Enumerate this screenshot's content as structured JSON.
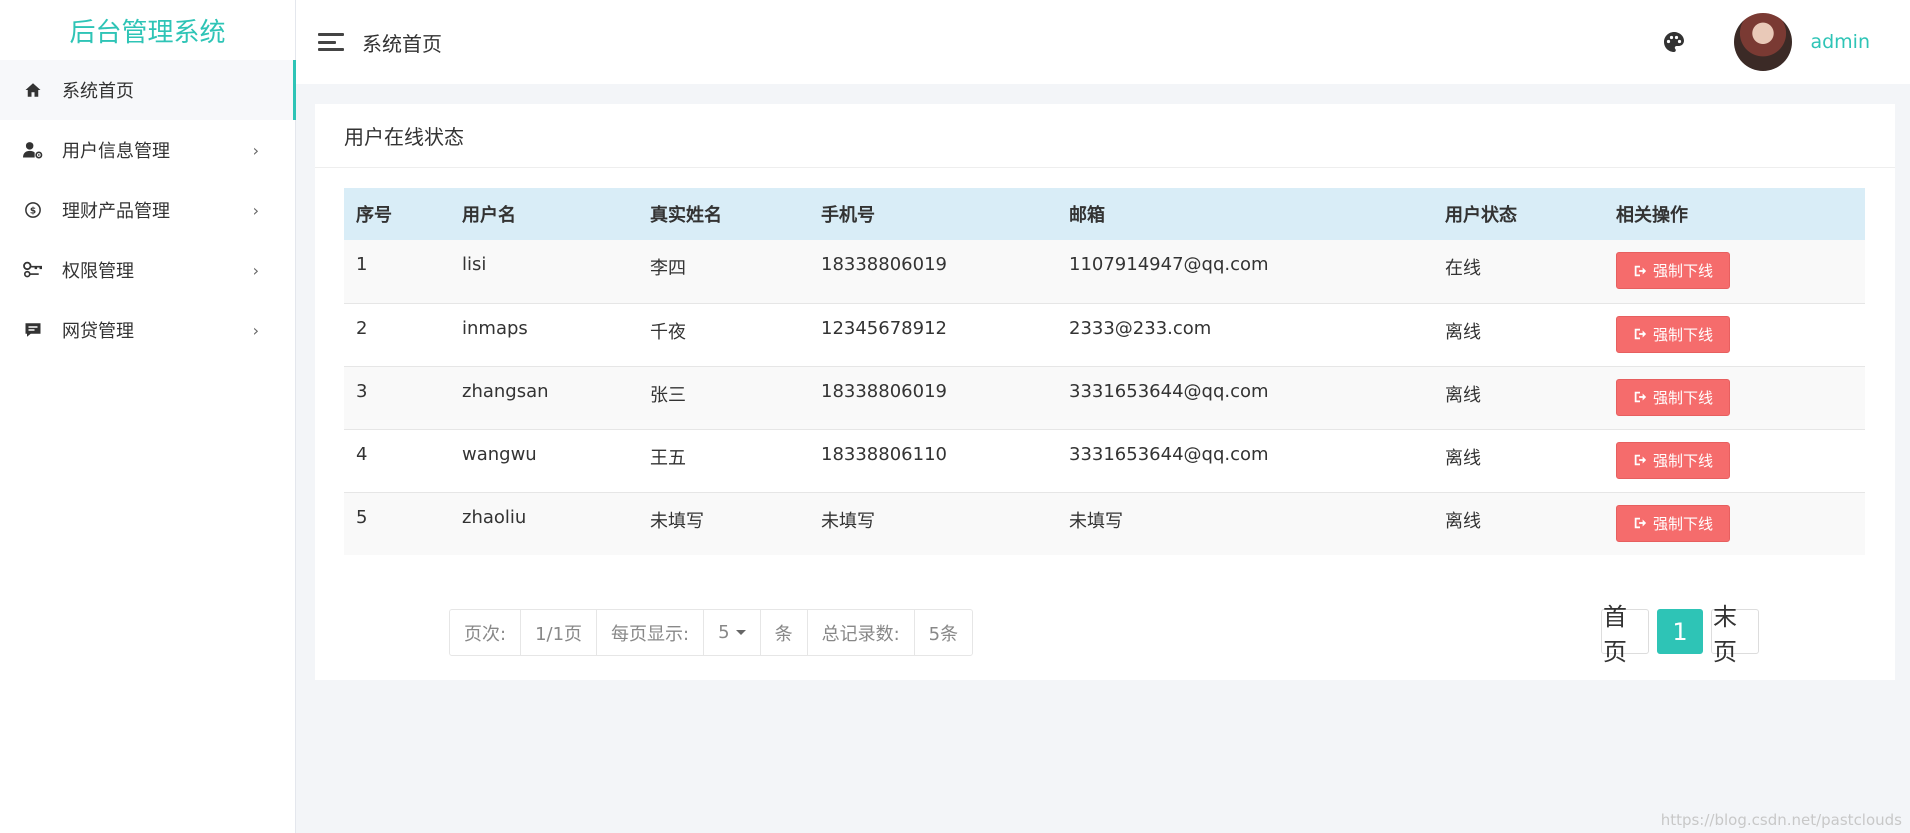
{
  "app": {
    "title": "后台管理系统"
  },
  "sidebar": {
    "items": [
      {
        "label": "系统首页",
        "icon": "home-icon",
        "active": true,
        "has_arrow": false
      },
      {
        "label": "用户信息管理",
        "icon": "user-settings-icon",
        "active": false,
        "has_arrow": true
      },
      {
        "label": "理财产品管理",
        "icon": "finance-icon",
        "active": false,
        "has_arrow": true
      },
      {
        "label": "权限管理",
        "icon": "key-icon",
        "active": false,
        "has_arrow": true
      },
      {
        "label": "网贷管理",
        "icon": "message-icon",
        "active": false,
        "has_arrow": true
      }
    ],
    "arrow": "›"
  },
  "header": {
    "breadcrumb": "系统首页",
    "username": "admin"
  },
  "card": {
    "title": "用户在线状态",
    "columns": [
      "序号",
      "用户名",
      "真实姓名",
      "手机号",
      "邮箱",
      "用户状态",
      "相关操作"
    ],
    "rows": [
      {
        "no": "1",
        "username": "lisi",
        "realname": "李四",
        "phone": "18338806019",
        "email": "1107914947@qq.com",
        "status": "在线",
        "action": "强制下线"
      },
      {
        "no": "2",
        "username": "inmaps",
        "realname": "千夜",
        "phone": "12345678912",
        "email": "2333@233.com",
        "status": "离线",
        "action": "强制下线"
      },
      {
        "no": "3",
        "username": "zhangsan",
        "realname": "张三",
        "phone": "18338806019",
        "email": "3331653644@qq.com",
        "status": "离线",
        "action": "强制下线"
      },
      {
        "no": "4",
        "username": "wangwu",
        "realname": "王五",
        "phone": "18338806110",
        "email": "3331653644@qq.com",
        "status": "离线",
        "action": "强制下线"
      },
      {
        "no": "5",
        "username": "zhaoliu",
        "realname": "未填写",
        "phone": "未填写",
        "email": "未填写",
        "status": "离线",
        "action": "强制下线"
      }
    ]
  },
  "pagination": {
    "page_label": "页次:",
    "page_value": "1/1页",
    "per_page_label": "每页显示:",
    "per_page_value": "5",
    "per_page_unit": "条",
    "total_label": "总记录数:",
    "total_value": "5条",
    "first": "首页",
    "current": "1",
    "last": "末页"
  },
  "watermark": "https://blog.csdn.net/pastclouds",
  "colors": {
    "accent": "#2ec4b6",
    "danger": "#f56c6c",
    "table_header": "#d9edf7"
  }
}
